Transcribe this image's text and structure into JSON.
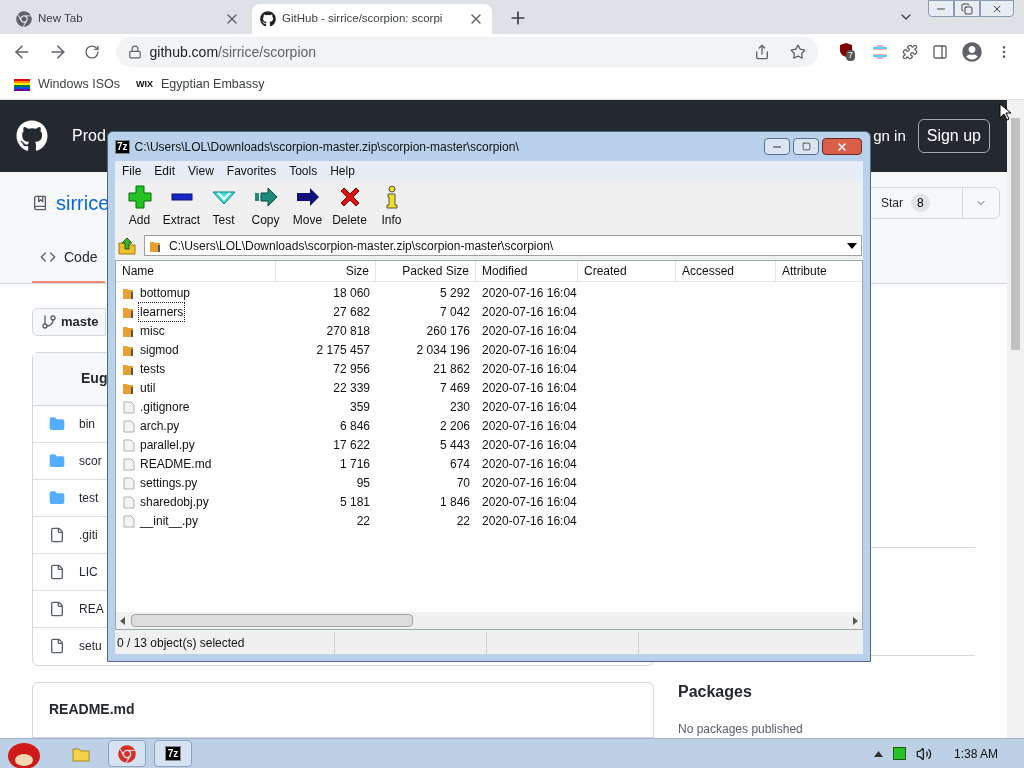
{
  "browser": {
    "tabs": [
      {
        "title": "New Tab",
        "kind": "chrome",
        "selected": false
      },
      {
        "title": "GitHub - sirrice/scorpion: scorpi",
        "kind": "github",
        "selected": true
      }
    ],
    "address": {
      "domain": "github.com",
      "path": "/sirrice/scorpion"
    },
    "extension_badge": "7",
    "bookmarks": [
      {
        "label": "Windows ISOs",
        "kind": "rainbow"
      },
      {
        "label": "Egyptian Embassy",
        "kind": "wix",
        "icon_text": "WIX"
      }
    ]
  },
  "github": {
    "nav_text": "Prod",
    "sign_in": "gn in",
    "sign_up": "Sign up",
    "repo_name": "sirrice",
    "star_label": "Star",
    "star_count": "8",
    "tabs": [
      {
        "label": "Code",
        "selected": true
      }
    ],
    "branch": "maste",
    "commit_author": "Eug",
    "files": [
      {
        "name": "bin",
        "kind": "folder"
      },
      {
        "name": "scor",
        "kind": "folder"
      },
      {
        "name": "test",
        "kind": "folder"
      },
      {
        "name": ".giti",
        "kind": "file"
      },
      {
        "name": "LIC",
        "kind": "file"
      },
      {
        "name": "REA",
        "kind": "file"
      },
      {
        "name": "setu",
        "kind": "file"
      }
    ],
    "readme_title": "README.md",
    "packages_title": "Packages",
    "packages_text": "No packages published"
  },
  "archive_window": {
    "icon_text": "7z",
    "title": "C:\\Users\\LOL\\Downloads\\scorpion-master.zip\\scorpion-master\\scorpion\\",
    "menu": [
      "File",
      "Edit",
      "View",
      "Favorites",
      "Tools",
      "Help"
    ],
    "toolbar": [
      {
        "label": "Add",
        "kind": "add"
      },
      {
        "label": "Extract",
        "kind": "extract"
      },
      {
        "label": "Test",
        "kind": "test"
      },
      {
        "label": "Copy",
        "kind": "copy"
      },
      {
        "label": "Move",
        "kind": "move"
      },
      {
        "label": "Delete",
        "kind": "delete"
      },
      {
        "label": "Info",
        "kind": "info"
      }
    ],
    "path": "C:\\Users\\LOL\\Downloads\\scorpion-master.zip\\scorpion-master\\scorpion\\",
    "columns": [
      "Name",
      "Size",
      "Packed Size",
      "Modified",
      "Created",
      "Accessed",
      "Attribute"
    ],
    "rows": [
      {
        "name": "bottomup",
        "kind": "folder",
        "size": "18 060",
        "packed": "5 292",
        "modified": "2020-07-16 16:04",
        "focused": false
      },
      {
        "name": "learners",
        "kind": "folder",
        "size": "27 682",
        "packed": "7 042",
        "modified": "2020-07-16 16:04",
        "focused": true
      },
      {
        "name": "misc",
        "kind": "folder",
        "size": "270 818",
        "packed": "260 176",
        "modified": "2020-07-16 16:04",
        "focused": false
      },
      {
        "name": "sigmod",
        "kind": "folder",
        "size": "2 175 457",
        "packed": "2 034 196",
        "modified": "2020-07-16 16:04",
        "focused": false
      },
      {
        "name": "tests",
        "kind": "folder",
        "size": "72 956",
        "packed": "21 862",
        "modified": "2020-07-16 16:04",
        "focused": false
      },
      {
        "name": "util",
        "kind": "folder",
        "size": "22 339",
        "packed": "7 469",
        "modified": "2020-07-16 16:04",
        "focused": false
      },
      {
        "name": ".gitignore",
        "kind": "file",
        "size": "359",
        "packed": "230",
        "modified": "2020-07-16 16:04",
        "focused": false
      },
      {
        "name": "arch.py",
        "kind": "file",
        "size": "6 846",
        "packed": "2 206",
        "modified": "2020-07-16 16:04",
        "focused": false
      },
      {
        "name": "parallel.py",
        "kind": "file",
        "size": "17 622",
        "packed": "5 443",
        "modified": "2020-07-16 16:04",
        "focused": false
      },
      {
        "name": "README.md",
        "kind": "file",
        "size": "1 716",
        "packed": "674",
        "modified": "2020-07-16 16:04",
        "focused": false
      },
      {
        "name": "settings.py",
        "kind": "file",
        "size": "95",
        "packed": "70",
        "modified": "2020-07-16 16:04",
        "focused": false
      },
      {
        "name": "sharedobj.py",
        "kind": "file",
        "size": "5 181",
        "packed": "1 846",
        "modified": "2020-07-16 16:04",
        "focused": false
      },
      {
        "name": "__init__.py",
        "kind": "file",
        "size": "22",
        "packed": "22",
        "modified": "2020-07-16 16:04",
        "focused": false
      }
    ],
    "status": "0 / 13 object(s) selected"
  },
  "taskbar": {
    "apps": [
      {
        "kind": "explorer",
        "active": false
      },
      {
        "kind": "chrome",
        "active": true
      },
      {
        "kind": "archiver",
        "active": true,
        "icon_text": "7z"
      }
    ],
    "time": "1:38 AM"
  }
}
